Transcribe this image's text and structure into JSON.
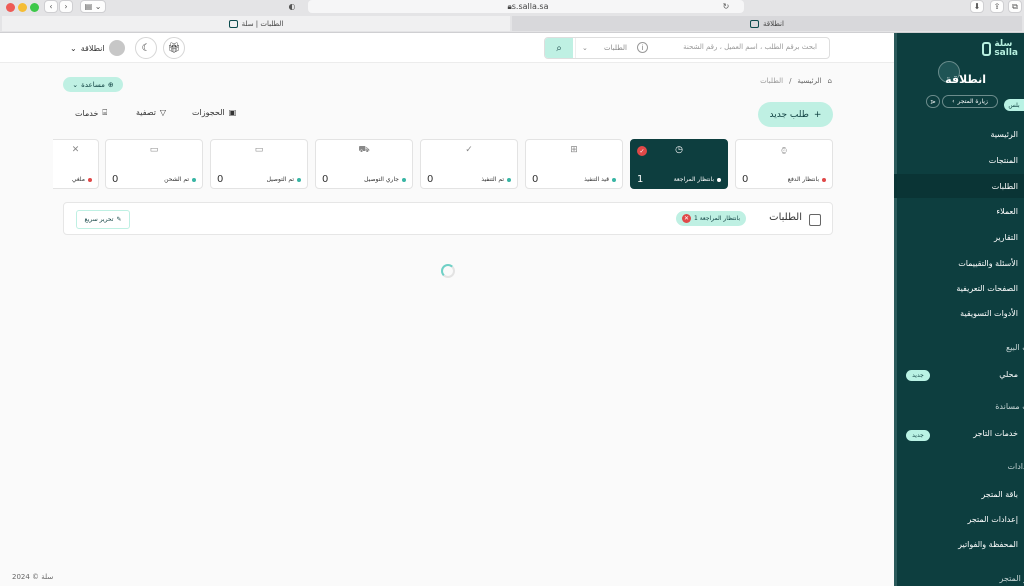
{
  "browser": {
    "url": "s.salla.sa",
    "tabs": [
      {
        "label": "الطلبات | سلة",
        "active": true
      },
      {
        "label": "انطلاقة",
        "active": false
      }
    ]
  },
  "sidebar": {
    "logo_ar": "سلة",
    "logo_en": "salla",
    "store_name": "انطلاقة",
    "plan_badge": "بلس",
    "visit_store": "زيارة المتجر",
    "items": [
      {
        "label": "الرئيسية"
      },
      {
        "label": "المنتجات"
      },
      {
        "label": "الطلبات",
        "active": true
      },
      {
        "label": "العملاء"
      },
      {
        "label": "التقارير"
      },
      {
        "label": "الأسئلة والتقييمات"
      },
      {
        "label": "الصفحات التعريفية"
      },
      {
        "label": "الأدوات التسويقية"
      }
    ],
    "section_sales": "ات البيع",
    "item_local": "محلي",
    "new_badge_1": "جديد",
    "section_support": "ات مساندة",
    "item_merchant_services": "خدمات التاجر",
    "new_badge_2": "جديد",
    "section_settings": "عدادات",
    "settings_items": [
      {
        "label": "باقة المتجر"
      },
      {
        "label": "إعدادات المتجر"
      },
      {
        "label": "المحفظة والفواتير"
      }
    ],
    "section_store_look": "هر المتجر"
  },
  "header": {
    "search_placeholder": "ابحث برقم الطلب ، اسم العميل ، رقم الشحنة",
    "search_scope": "الطلبات",
    "user_name": "انطلاقة"
  },
  "breadcrumb": {
    "home": "الرئيسية",
    "separator": "/",
    "current": "الطلبات"
  },
  "help_label": "مساعدة",
  "toolbar": {
    "new_order": "طلب جديد",
    "reservations": "الحجوزات",
    "filter": "تصفية",
    "services": "خدمات"
  },
  "status_cards": [
    {
      "label": "بانتظار الدفع",
      "count": "0",
      "icon": "watch-icon",
      "dot": "#e04848"
    },
    {
      "label": "بانتظار المراجعة",
      "count": "1",
      "icon": "clock-icon",
      "dot": "#ffffff",
      "active": true,
      "badge": "✓"
    },
    {
      "label": "قيد التنفيذ",
      "count": "0",
      "icon": "gift-icon",
      "dot": "#39b5a4"
    },
    {
      "label": "تم التنفيذ",
      "count": "0",
      "icon": "check-icon",
      "dot": "#39b5a4"
    },
    {
      "label": "جاري التوصيل",
      "count": "0",
      "icon": "truck-icon",
      "dot": "#39b5a4"
    },
    {
      "label": "تم التوصيل",
      "count": "0",
      "icon": "box-icon",
      "dot": "#39b5a4"
    },
    {
      "label": "تم الشحن",
      "count": "0",
      "icon": "box-icon",
      "dot": "#39b5a4"
    },
    {
      "label": "ملغي",
      "count": "0",
      "icon": "close-icon",
      "dot": "#e04848"
    }
  ],
  "orders": {
    "title": "الطلبات",
    "filter_chip": "بانتظار المراجعة 1",
    "quick_edit": "تحرير سريع"
  },
  "footer": "سلة © 2024",
  "colors": {
    "brand_dark": "#0d3e3f",
    "brand_light": "#bff0e3",
    "alert": "#e04848"
  }
}
